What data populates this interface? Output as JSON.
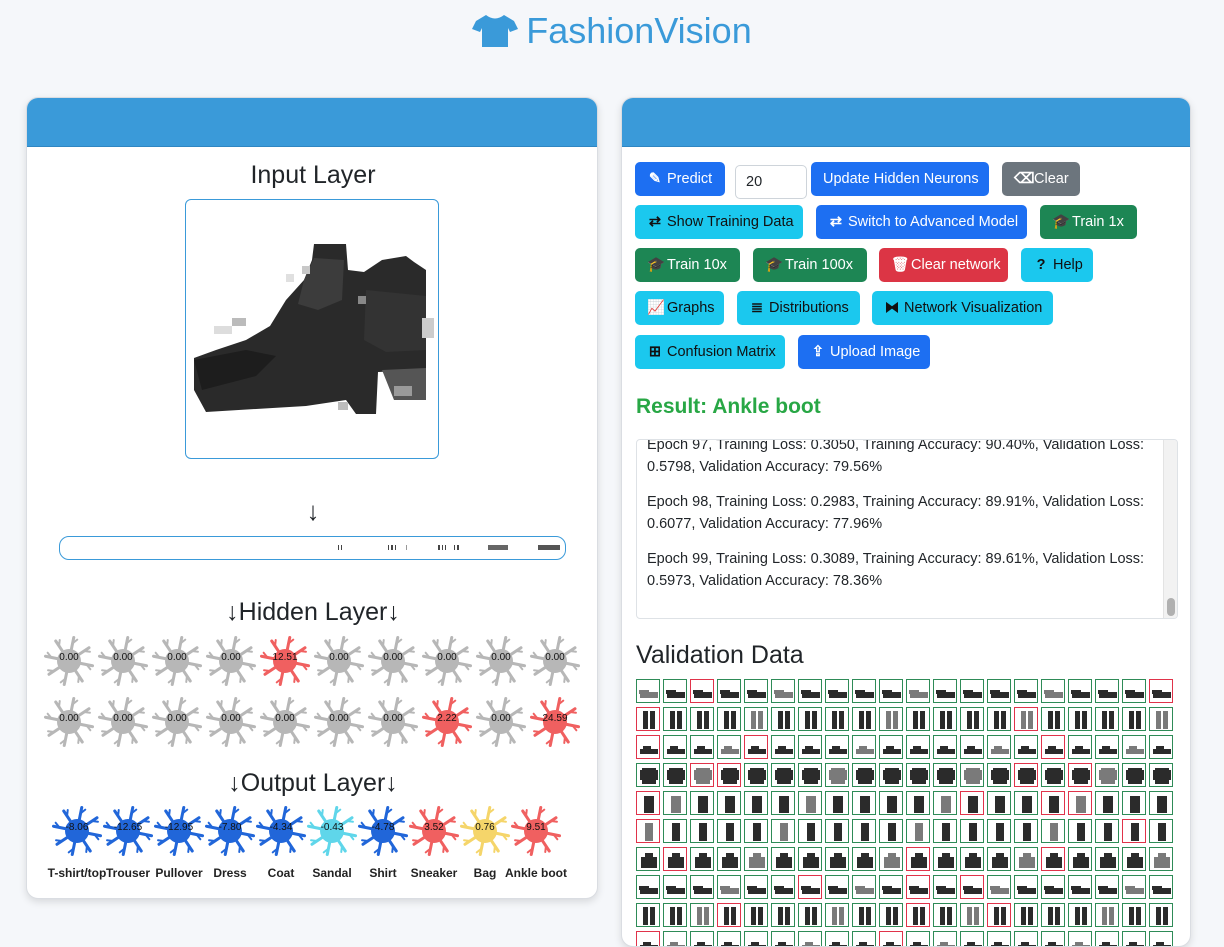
{
  "app": {
    "title": "FashionVision",
    "icon": "tshirt-icon"
  },
  "left_panel": {
    "input_title": "Input Layer",
    "arrow": "↓",
    "hidden_title": "↓Hidden Layer↓",
    "output_title": "↓Output Layer↓",
    "hidden_neurons": [
      {
        "value": "0.00",
        "state": "inactive"
      },
      {
        "value": "0.00",
        "state": "inactive"
      },
      {
        "value": "0.00",
        "state": "inactive"
      },
      {
        "value": "0.00",
        "state": "inactive"
      },
      {
        "value": "12.51",
        "state": "active"
      },
      {
        "value": "0.00",
        "state": "inactive"
      },
      {
        "value": "0.00",
        "state": "inactive"
      },
      {
        "value": "0.00",
        "state": "inactive"
      },
      {
        "value": "0.00",
        "state": "inactive"
      },
      {
        "value": "0.00",
        "state": "inactive"
      },
      {
        "value": "0.00",
        "state": "inactive"
      },
      {
        "value": "0.00",
        "state": "inactive"
      },
      {
        "value": "0.00",
        "state": "inactive"
      },
      {
        "value": "0.00",
        "state": "inactive"
      },
      {
        "value": "0.00",
        "state": "inactive"
      },
      {
        "value": "0.00",
        "state": "inactive"
      },
      {
        "value": "0.00",
        "state": "inactive"
      },
      {
        "value": "2.22",
        "state": "active"
      },
      {
        "value": "0.00",
        "state": "inactive"
      },
      {
        "value": "24.59",
        "state": "active"
      }
    ],
    "output_neurons": [
      {
        "value": "-8.06",
        "label": "T-shirt/top",
        "color": "#2166d9"
      },
      {
        "value": "-12.65",
        "label": "Trouser",
        "color": "#2166d9"
      },
      {
        "value": "-12.95",
        "label": "Pullover",
        "color": "#2166d9"
      },
      {
        "value": "-7.80",
        "label": "Dress",
        "color": "#2166d9"
      },
      {
        "value": "-4.34",
        "label": "Coat",
        "color": "#2166d9"
      },
      {
        "value": "-0.43",
        "label": "Sandal",
        "color": "#5fd6ea"
      },
      {
        "value": "-4.78",
        "label": "Shirt",
        "color": "#2166d9"
      },
      {
        "value": "3.52",
        "label": "Sneaker",
        "color": "#f06060"
      },
      {
        "value": "0.76",
        "label": "Bag",
        "color": "#f5d56a"
      },
      {
        "value": "9.51",
        "label": "Ankle boot",
        "color": "#f06060"
      }
    ]
  },
  "toolbar": {
    "predict": "Predict",
    "neurons_value": "20",
    "update_hidden": "Update Hidden Neurons",
    "clear": "Clear",
    "show_training": "Show Training Data",
    "switch_model": "Switch to Advanced Model",
    "train_1x": "Train 1x",
    "train_10x": "Train 10x",
    "train_100x": "Train 100x",
    "clear_network": "Clear network",
    "help": "Help",
    "graphs": "Graphs",
    "distributions": "Distributions",
    "network_viz": "Network Visualization",
    "confusion": "Confusion Matrix",
    "upload": "Upload Image"
  },
  "result": {
    "text": "Result: Ankle boot"
  },
  "log": [
    "Epoch 97, Training Loss: 0.3050, Training Accuracy: 90.40%, Validation Loss: 0.5798, Validation Accuracy: 79.56%",
    "Epoch 98, Training Loss: 0.2983, Training Accuracy: 89.91%, Validation Loss: 0.6077, Validation Accuracy: 77.96%",
    "Epoch 99, Training Loss: 0.3089, Training Accuracy: 89.61%, Validation Loss: 0.5973, Validation Accuracy: 78.36%"
  ],
  "validation": {
    "title": "Validation Data"
  },
  "colors": {
    "accent": "#3a9ad9",
    "correct": "#2e8b57",
    "incorrect": "#e0334a"
  }
}
